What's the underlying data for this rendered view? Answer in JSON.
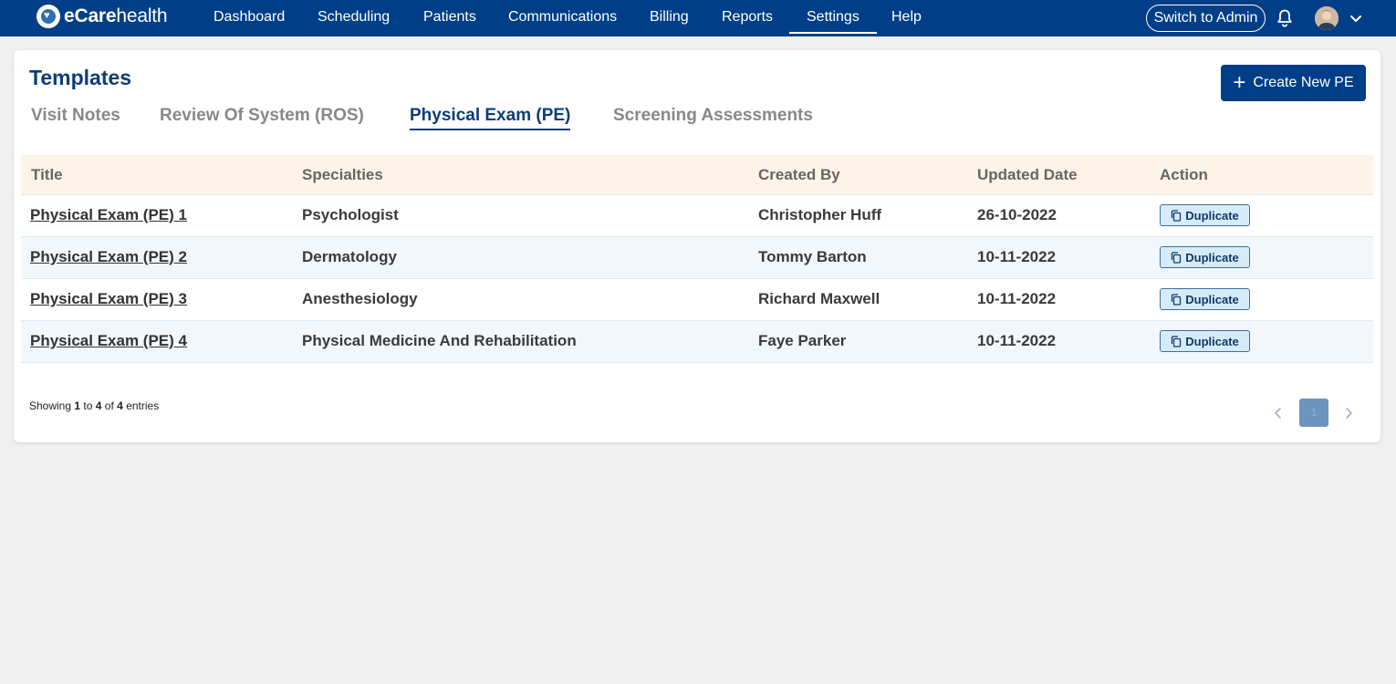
{
  "brand": {
    "name_bold": "eCare",
    "name_regular": "health"
  },
  "nav": {
    "items": [
      "Dashboard",
      "Scheduling",
      "Patients",
      "Communications",
      "Billing",
      "Reports",
      "Settings",
      "Help"
    ],
    "active": "Settings",
    "switch_admin": "Switch to Admin"
  },
  "page": {
    "title": "Templates",
    "create_button": "Create New PE",
    "tabs": [
      "Visit Notes",
      "Review Of System (ROS)",
      "Physical Exam (PE)",
      "Screening Assessments"
    ],
    "active_tab": "Physical Exam (PE)"
  },
  "table": {
    "headers": [
      "Title",
      "Specialties",
      "Created By",
      "Updated Date",
      "Action"
    ],
    "action_label": "Duplicate",
    "rows": [
      {
        "title": "Physical Exam (PE) 1",
        "specialty": "Psychologist",
        "created_by": "Christopher Huff",
        "updated": "26-10-2022"
      },
      {
        "title": "Physical Exam (PE) 2",
        "specialty": "Dermatology",
        "created_by": "Tommy Barton",
        "updated": "10-11-2022"
      },
      {
        "title": "Physical Exam (PE) 3",
        "specialty": "Anesthesiology",
        "created_by": "Richard Maxwell",
        "updated": "10-11-2022"
      },
      {
        "title": "Physical Exam (PE) 4",
        "specialty": "Physical Medicine And Rehabilitation",
        "created_by": "Faye Parker",
        "updated": "10-11-2022"
      }
    ]
  },
  "pagination": {
    "prefix": "Showing",
    "from": "1",
    "to_word": "to",
    "to": "4",
    "of_word": "of",
    "total": "4",
    "suffix": "entries",
    "current_page": "1"
  },
  "colors": {
    "navbar": "#003f87",
    "accent": "#0b3d7a",
    "header_bg": "#fdf3e6",
    "alt_row": "#f2f7fc"
  },
  "icons": [
    "heart-logo-icon",
    "bell-icon",
    "avatar",
    "chevron-down-icon",
    "plus-icon",
    "copy-icon",
    "chevron-left-icon",
    "chevron-right-icon"
  ]
}
